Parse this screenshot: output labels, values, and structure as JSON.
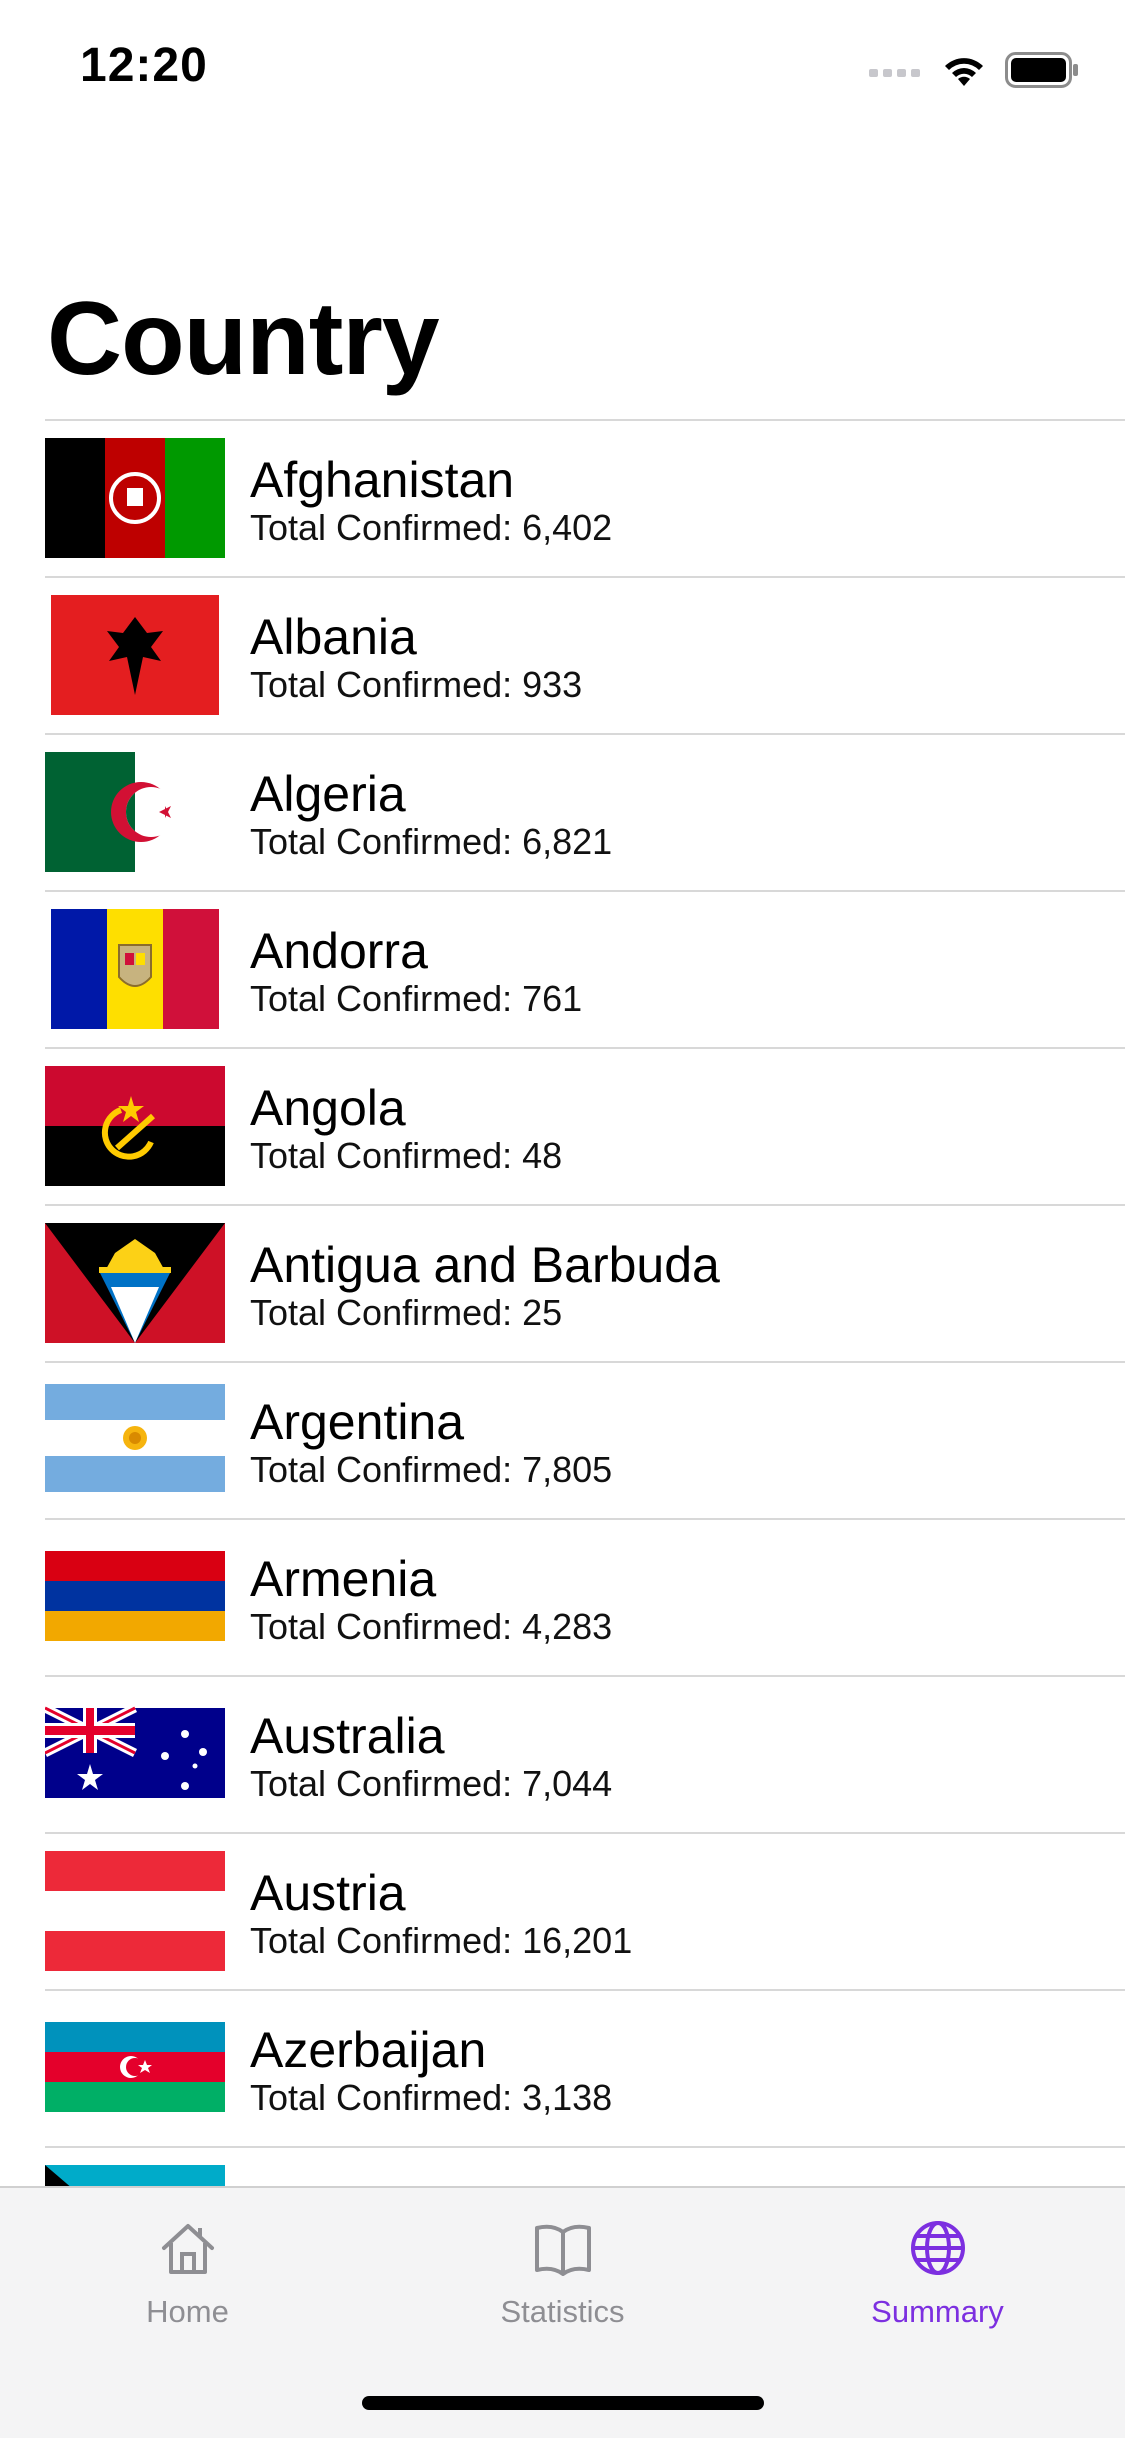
{
  "status_bar": {
    "time": "12:20"
  },
  "page": {
    "title": "Country"
  },
  "countries": [
    {
      "name": "Afghanistan",
      "total_label": "Total Confirmed: 6,402"
    },
    {
      "name": "Albania",
      "total_label": "Total Confirmed: 933"
    },
    {
      "name": "Algeria",
      "total_label": "Total Confirmed: 6,821"
    },
    {
      "name": "Andorra",
      "total_label": "Total Confirmed: 761"
    },
    {
      "name": "Angola",
      "total_label": "Total Confirmed: 48"
    },
    {
      "name": "Antigua and Barbuda",
      "total_label": "Total Confirmed: 25"
    },
    {
      "name": "Argentina",
      "total_label": "Total Confirmed: 7,805"
    },
    {
      "name": "Armenia",
      "total_label": "Total Confirmed: 4,283"
    },
    {
      "name": "Australia",
      "total_label": "Total Confirmed: 7,044"
    },
    {
      "name": "Austria",
      "total_label": "Total Confirmed: 16,201"
    },
    {
      "name": "Azerbaijan",
      "total_label": "Total Confirmed: 3,138"
    }
  ],
  "tabs": [
    {
      "label": "Home",
      "icon": "house-icon"
    },
    {
      "label": "Statistics",
      "icon": "book-icon"
    },
    {
      "label": "Summary",
      "icon": "globe-icon",
      "active": true
    }
  ],
  "colors": {
    "accent": "#7c2fe0",
    "inactive": "#8e8e93",
    "separator": "#d8d8d8"
  }
}
